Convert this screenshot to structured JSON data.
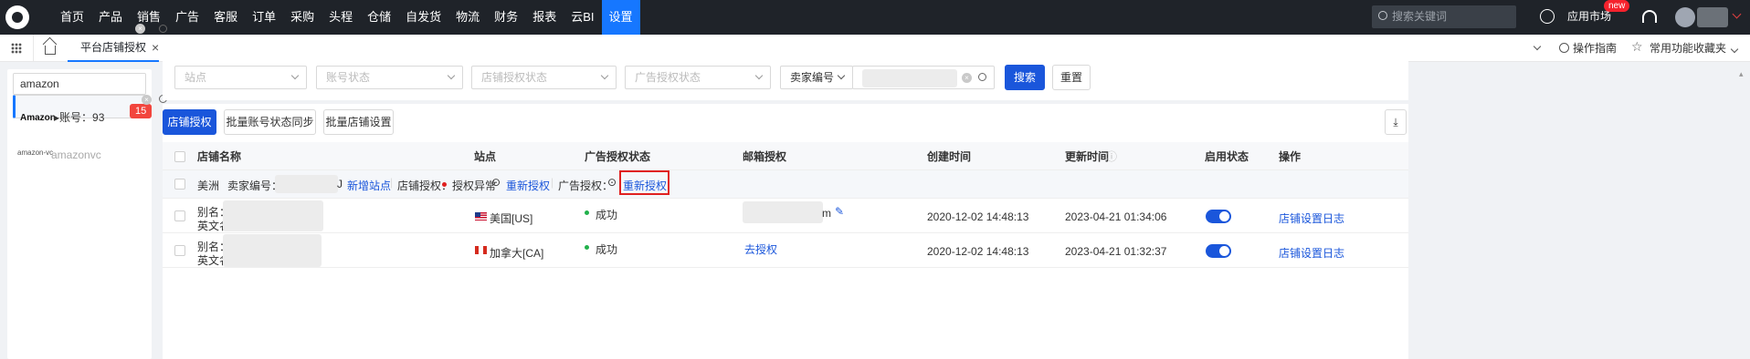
{
  "topnav": {
    "items": [
      "首页",
      "产品",
      "销售",
      "广告",
      "客服",
      "订单",
      "采购",
      "头程",
      "仓储",
      "自发货",
      "物流",
      "财务",
      "报表",
      "云BI",
      "设置"
    ],
    "active": "设置",
    "search_placeholder": "搜索关键词",
    "app_market": "应用市场",
    "new_badge": "new"
  },
  "tabbar": {
    "tab_label": "平台店铺授权",
    "close": "×",
    "guide": "操作指南",
    "favorites": "常用功能收藏夹"
  },
  "sidebar": {
    "search_value": "amazon",
    "items": [
      {
        "brand": "Amazon",
        "label": "账号：93",
        "count": "15"
      },
      {
        "brand": "amazon-vc",
        "label": "amazonvc"
      }
    ]
  },
  "filters": {
    "site": "站点",
    "account_status": "账号状态",
    "store_auth_status": "店铺授权状态",
    "ad_auth_status": "广告授权状态",
    "seller_id": "卖家编号",
    "search_btn": "搜索",
    "reset_btn": "重置"
  },
  "actions": {
    "store_auth": "店铺授权",
    "batch_sync": "批量账号状态同步",
    "batch_settings": "批量店铺设置"
  },
  "table": {
    "headers": [
      "店铺名称",
      "站点",
      "广告授权状态",
      "邮箱授权",
      "创建时间",
      "更新时间",
      "启用状态",
      "操作"
    ],
    "group": {
      "region": "美洲",
      "seller_label": "卖家编号：",
      "seller_tail": "J",
      "add_site": "新增站点",
      "store_auth_label": "店铺授权：",
      "store_auth_status": "授权异常",
      "reauth": "重新授权",
      "ad_auth_label": "广告授权：",
      "ad_reauth": "重新授权"
    },
    "rows": [
      {
        "alias": "别名：",
        "en_name": "英文名：",
        "site": "美国[US]",
        "ad_status": "成功",
        "email": "m",
        "created": "2020-12-02 14:48:13",
        "updated": "2023-04-21 01:34:06",
        "op_settings": "店铺设置",
        "op_log": "日志"
      },
      {
        "alias": "别名：",
        "en_name": "英文名：",
        "site": "加拿大[CA]",
        "ad_status": "成功",
        "email": "去授权",
        "created": "2020-12-02 14:48:13",
        "updated": "2023-04-21 01:32:37",
        "op_settings": "店铺设置",
        "op_log": "日志"
      }
    ]
  }
}
